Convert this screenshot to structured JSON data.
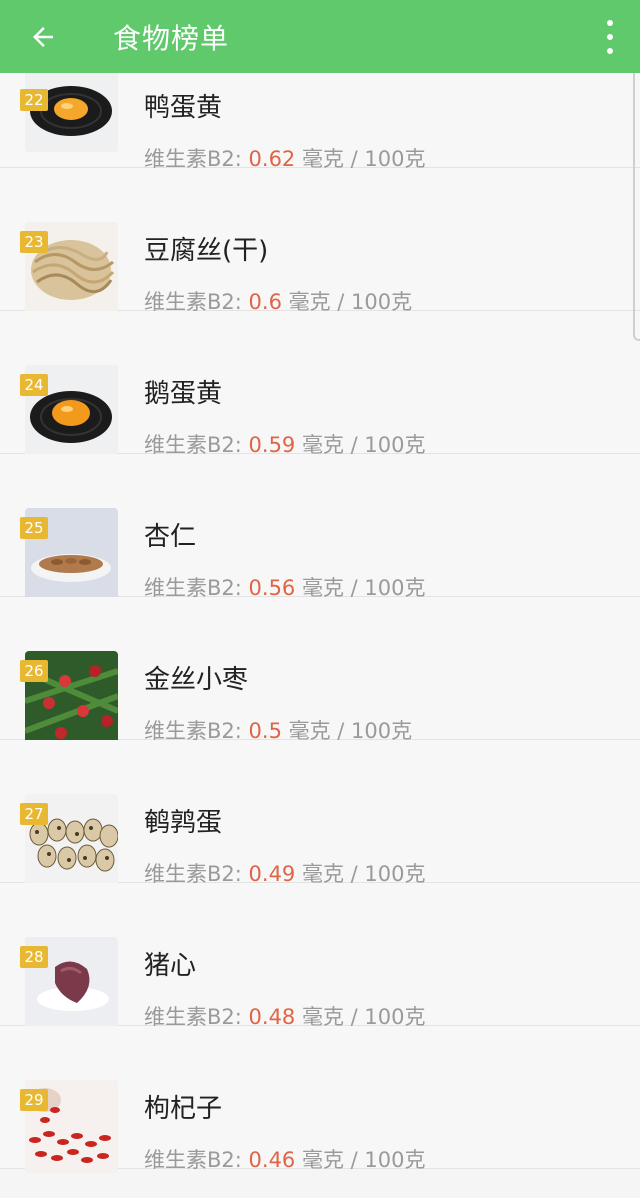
{
  "appbar": {
    "title": "食物榜单"
  },
  "unit_text": " 毫克 / 100克",
  "items": [
    {
      "rank": "22",
      "name": "鸭蛋黄",
      "label": "维生素B2: ",
      "value": "0.62",
      "image": "egg-yolk-on-plate"
    },
    {
      "rank": "23",
      "name": "豆腐丝(干)",
      "label": "维生素B2: ",
      "value": "0.6",
      "image": "dried-tofu-strips"
    },
    {
      "rank": "24",
      "name": "鹅蛋黄",
      "label": "维生素B2: ",
      "value": "0.59",
      "image": "egg-yolk-on-plate"
    },
    {
      "rank": "25",
      "name": "杏仁",
      "label": "维生素B2: ",
      "value": "0.56",
      "image": "almonds-on-plate"
    },
    {
      "rank": "26",
      "name": "金丝小枣",
      "label": "维生素B2: ",
      "value": "0.5",
      "image": "jujubes-on-branch"
    },
    {
      "rank": "27",
      "name": "鹌鹑蛋",
      "label": "维生素B2: ",
      "value": "0.49",
      "image": "quail-eggs"
    },
    {
      "rank": "28",
      "name": "猪心",
      "label": "维生素B2: ",
      "value": "0.48",
      "image": "pork-heart-on-plate"
    },
    {
      "rank": "29",
      "name": "枸杞子",
      "label": "维生素B2: ",
      "value": "0.46",
      "image": "goji-berries"
    }
  ]
}
